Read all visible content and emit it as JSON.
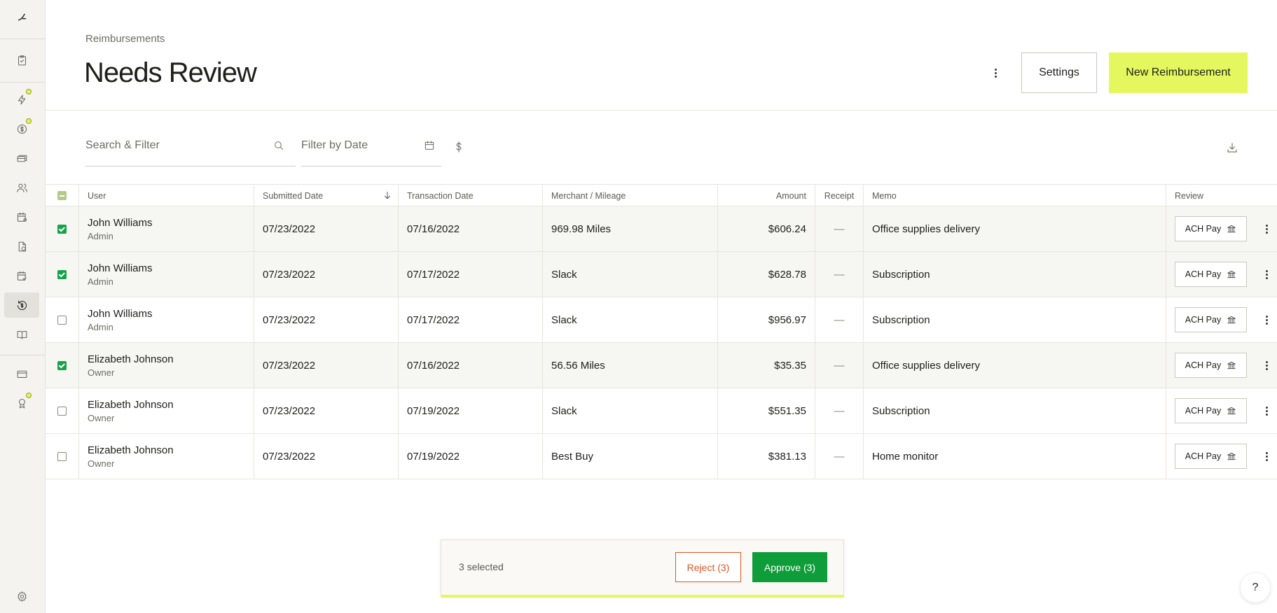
{
  "header": {
    "breadcrumb": "Reimbursements",
    "title": "Needs Review",
    "settings_label": "Settings",
    "new_label": "New Reimbursement"
  },
  "filters": {
    "search_placeholder": "Search & Filter",
    "date_placeholder": "Filter by Date"
  },
  "sidebar": {
    "items": [
      {
        "icon": "logo-icon"
      },
      {
        "icon": "clipboard-icon"
      },
      {
        "icon": "lightning-icon",
        "dot": true
      },
      {
        "icon": "dollar-circle-icon",
        "dot": true
      },
      {
        "icon": "cards-icon"
      },
      {
        "icon": "users-icon"
      },
      {
        "icon": "calendar-settings-icon"
      },
      {
        "icon": "document-dollar-icon"
      },
      {
        "icon": "calendar-check-icon"
      },
      {
        "icon": "reimbursement-icon",
        "active": true
      },
      {
        "icon": "book-icon"
      },
      {
        "icon": "credit-card-icon"
      },
      {
        "icon": "award-icon",
        "dot": true
      },
      {
        "icon": "gear-icon"
      }
    ]
  },
  "table": {
    "columns": {
      "user": "User",
      "submitted": "Submitted Date",
      "transaction": "Transaction Date",
      "merchant": "Merchant / Mileage",
      "amount": "Amount",
      "receipt": "Receipt",
      "memo": "Memo",
      "review": "Review"
    },
    "rows": [
      {
        "checked": true,
        "name": "John Williams",
        "role": "Admin",
        "submitted": "07/23/2022",
        "transaction": "07/16/2022",
        "merchant": "969.98 Miles",
        "amount": "$606.24",
        "receipt": "—",
        "memo": "Office supplies delivery",
        "action": "ACH Pay"
      },
      {
        "checked": true,
        "name": "John Williams",
        "role": "Admin",
        "submitted": "07/23/2022",
        "transaction": "07/17/2022",
        "merchant": "Slack",
        "amount": "$628.78",
        "receipt": "—",
        "memo": "Subscription",
        "action": "ACH Pay"
      },
      {
        "checked": false,
        "name": "John Williams",
        "role": "Admin",
        "submitted": "07/23/2022",
        "transaction": "07/17/2022",
        "merchant": "Slack",
        "amount": "$956.97",
        "receipt": "—",
        "memo": "Subscription",
        "action": "ACH Pay"
      },
      {
        "checked": true,
        "name": "Elizabeth Johnson",
        "role": "Owner",
        "submitted": "07/23/2022",
        "transaction": "07/16/2022",
        "merchant": "56.56 Miles",
        "amount": "$35.35",
        "receipt": "—",
        "memo": "Office supplies delivery",
        "action": "ACH Pay"
      },
      {
        "checked": false,
        "name": "Elizabeth Johnson",
        "role": "Owner",
        "submitted": "07/23/2022",
        "transaction": "07/19/2022",
        "merchant": "Slack",
        "amount": "$551.35",
        "receipt": "—",
        "memo": "Subscription",
        "action": "ACH Pay"
      },
      {
        "checked": false,
        "name": "Elizabeth Johnson",
        "role": "Owner",
        "submitted": "07/23/2022",
        "transaction": "07/19/2022",
        "merchant": "Best Buy",
        "amount": "$381.13",
        "receipt": "—",
        "memo": "Home monitor",
        "action": "ACH Pay"
      }
    ]
  },
  "bulk_bar": {
    "selected_text": "3 selected",
    "reject_label": "Reject (3)",
    "approve_label": "Approve (3)"
  },
  "help": {
    "label": "?"
  },
  "colors": {
    "accent": "#e4f75e",
    "approve": "#0f9d3a",
    "reject": "#e0561f",
    "check": "#16a34a"
  }
}
